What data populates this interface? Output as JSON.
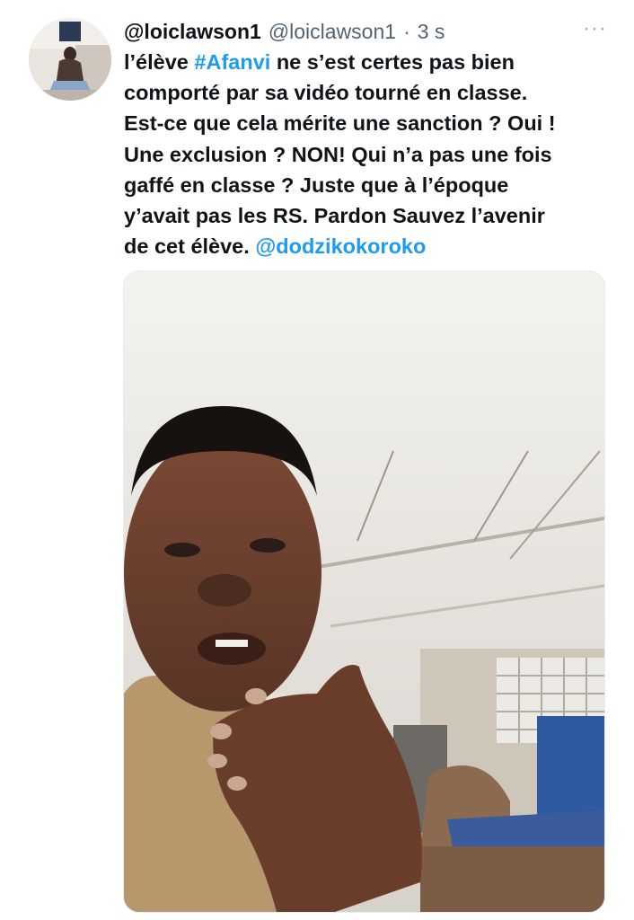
{
  "tweet": {
    "display_name": "@loiclawson1",
    "handle": "@loiclawson1",
    "separator": "·",
    "time": "3 s",
    "more_label": "···",
    "lines": [
      [
        {
          "t": "l’élève "
        },
        {
          "t": "#Afanvi",
          "link": true
        },
        {
          "t": " ne s’est certes pas bien"
        }
      ],
      [
        {
          "t": "comporté par sa vidéo tourné en classe."
        }
      ],
      [
        {
          "t": "Est-ce que cela mérite une sanction ? Oui !"
        }
      ],
      [
        {
          "t": "Une exclusion ? NON! Qui n’a pas une fois"
        }
      ],
      [
        {
          "t": "gaffé en classe ? Juste que à l’époque"
        }
      ],
      [
        {
          "t": "y’avait pas les RS. Pardon Sauvez l’avenir"
        }
      ],
      [
        {
          "t": "de cet élève. "
        },
        {
          "t": "@dodzikokoroko",
          "link": true
        }
      ]
    ]
  },
  "icons": {
    "avatar": "user-avatar-photo",
    "more": "more-options-icon"
  },
  "colors": {
    "link": "#1d9bf0",
    "secondary": "#536471",
    "text": "#0f1419"
  }
}
